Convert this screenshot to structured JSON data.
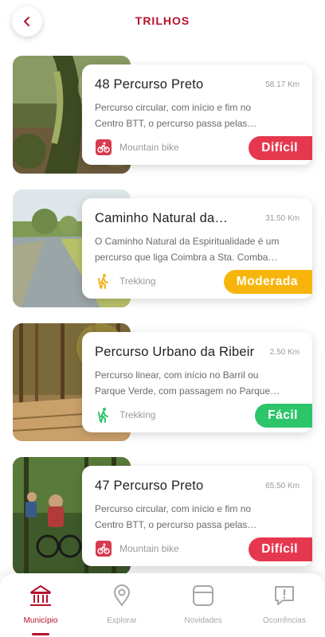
{
  "header": {
    "title": "TRILHOS"
  },
  "trails": [
    {
      "title": "48 Percurso Preto",
      "distance": "58.17 Km",
      "desc1": "Percurso circular, com início e fim no",
      "desc2": "Centro BTT, o percurso passa pelas…",
      "type": "Mountain bike",
      "type_icon": "mountain-bike-icon",
      "difficulty": "Difícil",
      "difficulty_color": "#e5384f"
    },
    {
      "title": "Caminho Natural da…",
      "distance": "31.50 Km",
      "desc1": "O Caminho Natural da Espiritualidade é um",
      "desc2": "percurso que liga Coimbra a Sta. Comba…",
      "type": "Trekking",
      "type_icon": "trekking-icon",
      "difficulty": "Moderada",
      "difficulty_color": "#f7b50b"
    },
    {
      "title": "Percurso Urbano da Ribeir…",
      "distance": "2.50 Km",
      "desc1": "Percurso linear, com início no Barril ou",
      "desc2": "Parque Verde, com passagem no Parque…",
      "type": "Trekking",
      "type_icon": "trekking-icon",
      "difficulty": "Fácil",
      "difficulty_color": "#2cc56a"
    },
    {
      "title": "47 Percurso Preto",
      "distance": "65.50 Km",
      "desc1": "Percurso circular, com início e fim no",
      "desc2": "Centro BTT, o percurso passa pelas…",
      "type": "Mountain bike",
      "type_icon": "mountain-bike-icon",
      "difficulty": "Difícil",
      "difficulty_color": "#e5384f"
    }
  ],
  "nav": {
    "items": [
      {
        "label": "Município",
        "icon": "municipality-icon",
        "active": true
      },
      {
        "label": "Explorar",
        "icon": "map-pin-icon",
        "active": false
      },
      {
        "label": "Novidades",
        "icon": "news-icon",
        "active": false
      },
      {
        "label": "Ocorrências",
        "icon": "report-icon",
        "active": false
      }
    ]
  },
  "colors": {
    "accent": "#b5122a",
    "muted": "#a7a7a7"
  }
}
